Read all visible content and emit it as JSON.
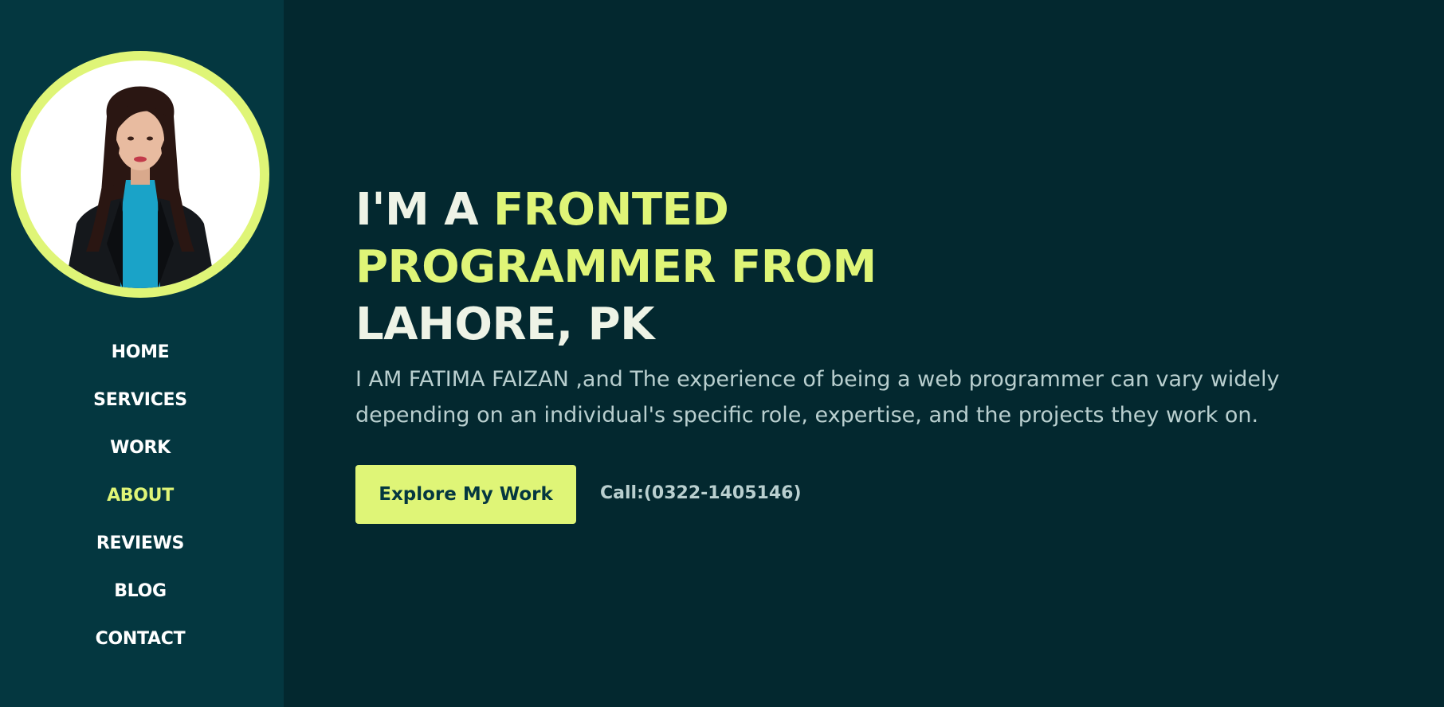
{
  "sidebar": {
    "avatar_alt": "Profile photo",
    "nav": [
      {
        "label": "HOME",
        "active": false
      },
      {
        "label": "SERVICES",
        "active": false
      },
      {
        "label": "WORK",
        "active": false
      },
      {
        "label": "ABOUT",
        "active": true
      },
      {
        "label": "REVIEWS",
        "active": false
      },
      {
        "label": "BLOG",
        "active": false
      },
      {
        "label": "CONTACT",
        "active": false
      }
    ]
  },
  "hero": {
    "headline_part1": "I'M A ",
    "headline_accent_1": "FRONTED",
    "headline_accent_2": "PROGRAMMER FROM",
    "headline_part2": "LAHORE, PK",
    "lead": "I AM FATIMA FAIZAN ,and The experience of being a web programmer can vary widely depending on an individual's specific role, expertise, and the projects they work on.",
    "cta_label": "Explore My Work",
    "phone_text": "Call:(0322-1405146)"
  },
  "colors": {
    "background": "#03282f",
    "sidebar": "#043740",
    "accent": "#dff577",
    "text_light": "#eef3e6",
    "text_muted": "#b9cfcf"
  }
}
